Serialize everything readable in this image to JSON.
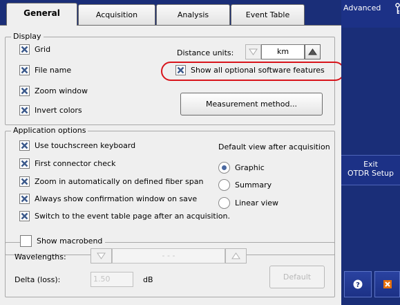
{
  "tabs": [
    {
      "label": "General",
      "active": true
    },
    {
      "label": "Acquisition",
      "active": false
    },
    {
      "label": "Analysis",
      "active": false
    },
    {
      "label": "Event Table",
      "active": false
    }
  ],
  "display": {
    "legend": "Display",
    "checkboxes": [
      {
        "label": "Grid",
        "checked": true
      },
      {
        "label": "File name",
        "checked": true
      },
      {
        "label": "Zoom window",
        "checked": true
      },
      {
        "label": "Invert colors",
        "checked": true
      }
    ],
    "distance_units_label": "Distance units:",
    "distance_units_value": "km",
    "show_optional_label": "Show all optional software features",
    "show_optional_checked": true,
    "measurement_button": "Measurement method..."
  },
  "app_options": {
    "legend": "Application options",
    "checkboxes": [
      {
        "label": "Use touchscreen keyboard",
        "checked": true
      },
      {
        "label": "First connector check",
        "checked": true
      },
      {
        "label": "Zoom in automatically on defined fiber span",
        "checked": true
      },
      {
        "label": "Always show confirmation window on save",
        "checked": true
      },
      {
        "label": "Switch to the event table page after an acquisition.",
        "checked": true
      }
    ],
    "default_view_label": "Default view after acquisition",
    "views": [
      {
        "label": "Graphic",
        "selected": true
      },
      {
        "label": "Summary",
        "selected": false
      },
      {
        "label": "Linear view",
        "selected": false
      }
    ]
  },
  "macrobend": {
    "legend": "Show macrobend",
    "checked": false,
    "wavelengths_label": "Wavelengths:",
    "wavelengths_value": "- - -",
    "delta_label": "Delta (loss):",
    "delta_value": "1.50",
    "delta_unit": "dB",
    "default_button": "Default"
  },
  "sidebar": {
    "advanced": "Advanced",
    "exit_line1": "Exit",
    "exit_line2": "OTDR Setup",
    "colors": {
      "accent": "#1a2e78",
      "close": "#e8700a",
      "help": "#1a2e78"
    }
  },
  "icons": {
    "check": "checkmark-x-icon",
    "down": "triangle-down-icon",
    "up": "triangle-up-icon",
    "help": "help-icon",
    "close": "close-icon"
  }
}
